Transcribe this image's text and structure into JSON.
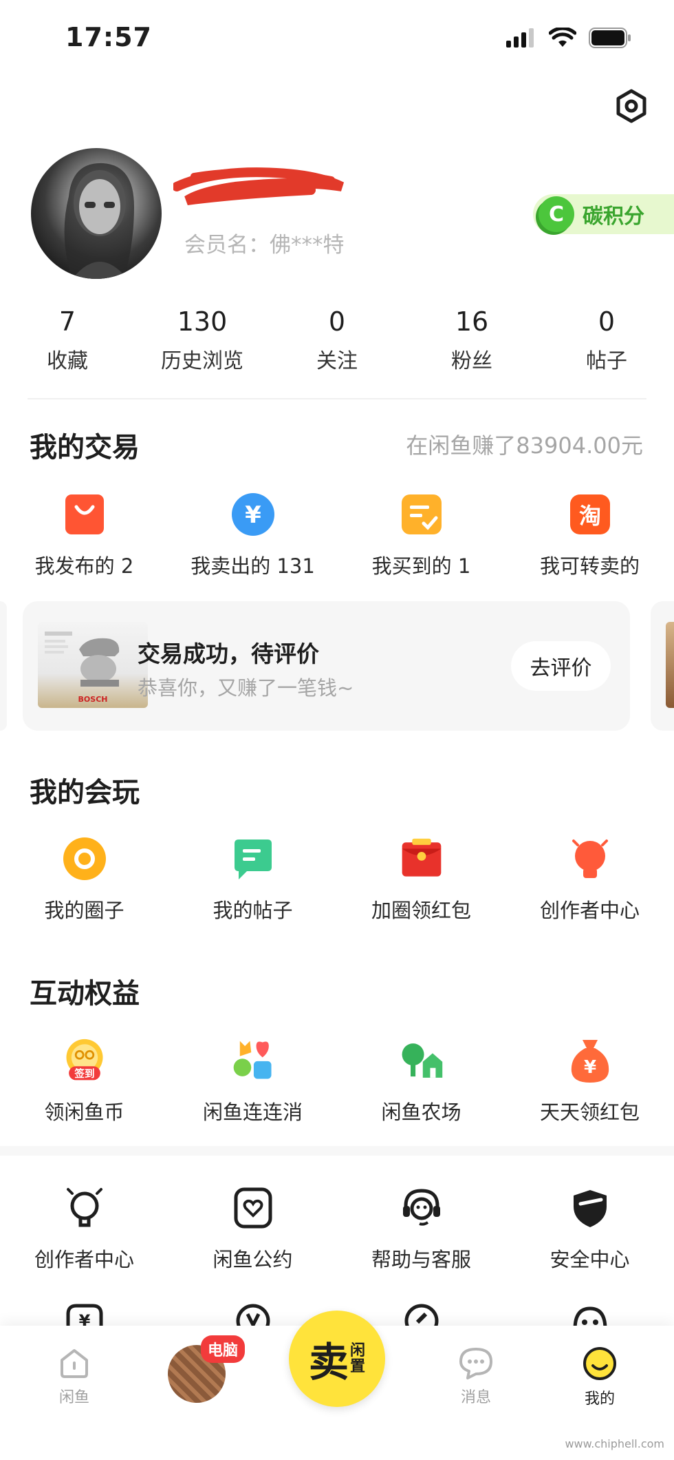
{
  "status": {
    "time": "17:57"
  },
  "profile": {
    "member_name": "会员名：佛***特",
    "carbon_label": "碳积分",
    "carbon_letter": "C"
  },
  "stats": [
    {
      "value": "7",
      "label": "收藏"
    },
    {
      "value": "130",
      "label": "历史浏览"
    },
    {
      "value": "0",
      "label": "关注"
    },
    {
      "value": "16",
      "label": "粉丝"
    },
    {
      "value": "0",
      "label": "帖子"
    }
  ],
  "trade": {
    "title": "我的交易",
    "earned": "在闲鱼赚了83904.00元",
    "items": [
      {
        "label": "我发布的 2",
        "icon": "shopping-bag-icon",
        "color": "#ff5533"
      },
      {
        "label": "我卖出的 131",
        "icon": "yuan-coin-icon",
        "color": "#3a9bf5"
      },
      {
        "label": "我买到的 1",
        "icon": "order-check-icon",
        "color": "#ffb12a"
      },
      {
        "label": "我可转卖的",
        "icon": "taobao-icon",
        "color": "#ff5a1f"
      }
    ],
    "review_card": {
      "title": "交易成功，待评价",
      "subtitle": "恭喜你，又赚了一笔钱~",
      "button": "去评价",
      "product_brand": "BOSCH"
    }
  },
  "play": {
    "title": "我的会玩",
    "items": [
      {
        "label": "我的圈子",
        "icon": "circle-icon"
      },
      {
        "label": "我的帖子",
        "icon": "post-icon"
      },
      {
        "label": "加圈领红包",
        "icon": "red-envelope-icon"
      },
      {
        "label": "创作者中心",
        "icon": "lightbulb-icon"
      }
    ]
  },
  "benefits": {
    "title": "互动权益",
    "items": [
      {
        "label": "领闲鱼币",
        "icon": "checkin-coin-icon",
        "badge": "签到"
      },
      {
        "label": "闲鱼连连消",
        "icon": "match-game-icon"
      },
      {
        "label": "闲鱼农场",
        "icon": "farm-icon"
      },
      {
        "label": "天天领红包",
        "icon": "money-bag-icon",
        "glyph": "¥"
      }
    ]
  },
  "services": {
    "items": [
      {
        "label": "创作者中心",
        "icon": "lightbulb-outline-icon"
      },
      {
        "label": "闲鱼公约",
        "icon": "convention-icon"
      },
      {
        "label": "帮助与客服",
        "icon": "customer-service-icon"
      },
      {
        "label": "安全中心",
        "icon": "shield-icon"
      }
    ]
  },
  "nav": {
    "home": "闲鱼",
    "pc_badge": "电脑",
    "sell_main": "卖",
    "sell_side_1": "闲",
    "sell_side_2": "置",
    "messages": "消息",
    "mine": "我的"
  },
  "watermark": "www.chiphell.com"
}
